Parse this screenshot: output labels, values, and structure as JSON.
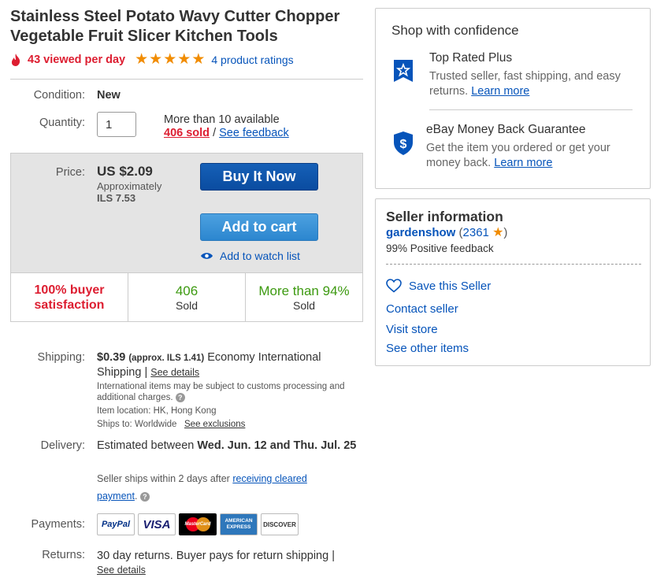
{
  "listing": {
    "title": "Stainless Steel Potato Wavy Cutter Chopper Vegetable Fruit Slicer Kitchen Tools",
    "viewed": "43 viewed per day",
    "stars": 5,
    "ratings": "4 product ratings"
  },
  "condition": {
    "label": "Condition:",
    "value": "New"
  },
  "quantity": {
    "label": "Quantity:",
    "value": "1",
    "available": "More than 10 available",
    "sold": "406 sold",
    "separator": "/",
    "feedback": "See feedback"
  },
  "price": {
    "label": "Price:",
    "value": "US $2.09",
    "approx_label": "Approximately",
    "approx_value": "ILS 7.53",
    "buy_now": "Buy It Now",
    "add_to_cart": "Add to cart",
    "watch": "Add to watch list"
  },
  "stats": [
    {
      "main": "100% buyer satisfaction",
      "sub": ""
    },
    {
      "main": "406",
      "sub": "Sold"
    },
    {
      "main": "More than 94%",
      "sub": "Sold"
    }
  ],
  "shipping": {
    "label": "Shipping:",
    "price": "$0.39",
    "approx": "(approx. ILS 1.41)",
    "method": "Economy International Shipping |",
    "details": "See details",
    "customs": "International items may be subject to customs processing and additional charges.",
    "location": "Item location:  HK, Hong Kong",
    "ships_to": "Ships to:  Worldwide",
    "exclusions": "See exclusions"
  },
  "delivery": {
    "label": "Delivery:",
    "prefix": "Estimated between",
    "dates": "Wed. Jun. 12 and Thu. Jul. 25",
    "note_prefix": "Seller ships within 2 days after",
    "note_link": "receiving cleared payment",
    "note_suffix": "."
  },
  "payments": {
    "label": "Payments:",
    "methods": [
      "PayPal",
      "VISA",
      "MasterCard",
      "AMERICAN EXPRESS",
      "DISCOVER"
    ]
  },
  "returns": {
    "label": "Returns:",
    "text": "30 day returns. Buyer pays for return shipping |",
    "details": "See details"
  },
  "confidence": {
    "title": "Shop with confidence",
    "items": [
      {
        "icon": "star-badge-icon",
        "title": "Top Rated Plus",
        "text": "Trusted seller, fast shipping, and easy returns.",
        "link": "Learn more"
      },
      {
        "icon": "dollar-shield-icon",
        "title": "eBay Money Back Guarantee",
        "text": "Get the item you ordered or get your money back.",
        "link": "Learn more"
      }
    ]
  },
  "seller": {
    "title": "Seller information",
    "name": "gardenshow",
    "score": "2361",
    "feedback": "99% Positive feedback",
    "save": "Save this Seller",
    "contact": "Contact seller",
    "store": "Visit store",
    "other": "See other items"
  },
  "colors": {
    "accent": "#0654ba",
    "alert": "#dd1e31",
    "star": "#f18c00",
    "green": "#3d9a11"
  }
}
